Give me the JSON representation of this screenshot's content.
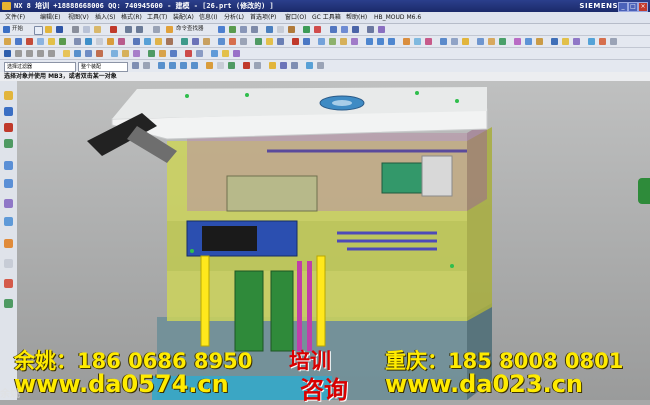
{
  "window": {
    "title": "NX 8 培训 +18888668006  QQ: 740945600  - 建模 - [26.prt (修改的) ]",
    "brand": "SIEMENS",
    "controls": [
      "_",
      "□",
      "×"
    ]
  },
  "menu": {
    "items": [
      "文件(F)",
      "编辑(E)",
      "视图(V)",
      "插入(S)",
      "格式(R)",
      "工具(T)",
      "装配(A)",
      "信息(I)",
      "分析(L)",
      "首选项(P)",
      "窗口(O)",
      "GC 工具箱",
      "帮助(H)",
      "HB_MOUD M6.6"
    ]
  },
  "toolbar": {
    "start_label": "开始",
    "command_finder_label": "命令查找器",
    "selection_filter": "选择过滤器",
    "assembly_scope": "整个装配"
  },
  "status": {
    "prompt": "选择对象并使用 MB3，或者双击某一对象"
  },
  "promo": {
    "line1_left": "余姚：186 0686 8950",
    "line1_mid": "培训",
    "line1_right": "重庆：185 8008 0801",
    "line2_left": "www.da0574.cn",
    "line2_mid": "咨询",
    "line2_right": "www.da023.cn",
    "watermark": "余姚"
  },
  "colors": {
    "title_bar": "#1e2f73",
    "plate_top": "#f2f3f3",
    "plate_yellow": "#d8d45a",
    "pillar_green": "#2f8a3a",
    "promo_yellow": "#ffeb00",
    "promo_red": "#d80000"
  }
}
